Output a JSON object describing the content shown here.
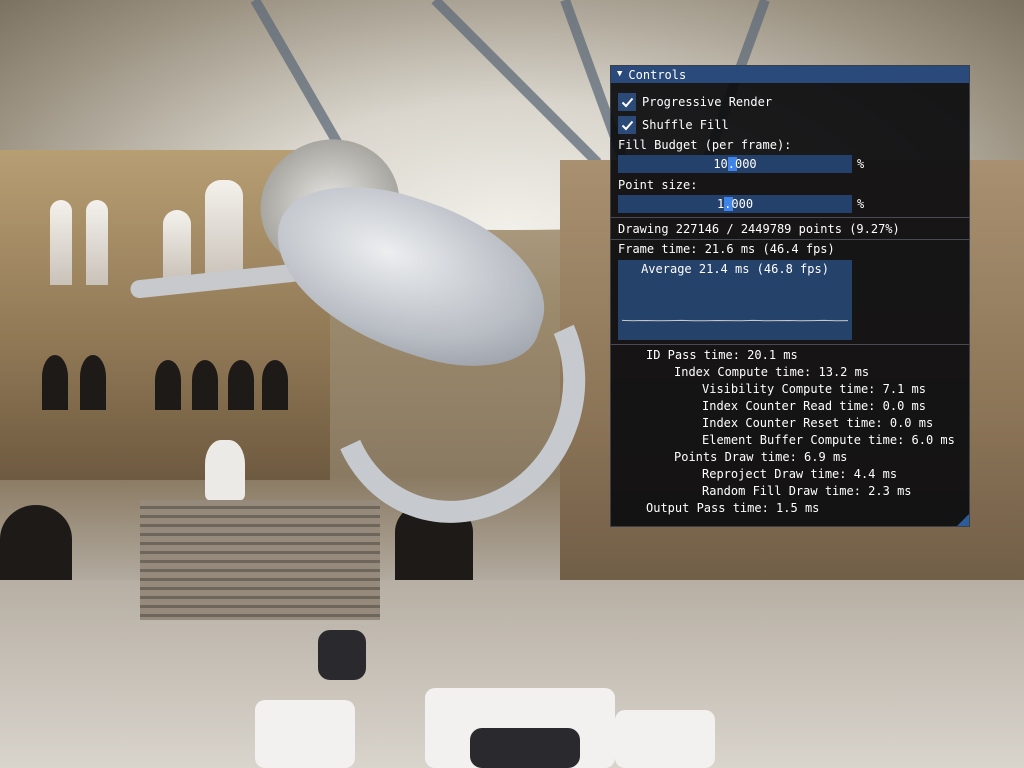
{
  "window": {
    "title": "Controls"
  },
  "controls": {
    "progressive_render": {
      "label": "Progressive Render",
      "checked": true
    },
    "shuffle_fill": {
      "label": "Shuffle Fill",
      "checked": true
    },
    "fill_budget": {
      "label": "Fill Budget (per frame):",
      "value": "10.000",
      "suffix": "%",
      "fraction": 0.49
    },
    "point_size": {
      "label": "Point size:",
      "value": "1.000",
      "suffix": "%",
      "fraction": 0.47
    },
    "drawing_stats": "Drawing 227146 / 2449789 points (9.27%)",
    "frame_time": "Frame time: 21.6 ms (46.4 fps)",
    "plot": {
      "overlay": "Average 21.4 ms (46.8 fps)",
      "samples": [
        21.6,
        21.3,
        21.5,
        21.2,
        21.4,
        21.7,
        21.3,
        21.1,
        21.5,
        21.4,
        21.2,
        21.6,
        21.3,
        21.4,
        21.5,
        21.2,
        21.4,
        21.6,
        21.3,
        21.4
      ],
      "scale_max": 100
    },
    "timings": [
      {
        "level": 0,
        "text": "ID Pass time: 20.1 ms"
      },
      {
        "level": 1,
        "text": "Index Compute time: 13.2 ms"
      },
      {
        "level": 2,
        "text": "Visibility Compute time: 7.1 ms"
      },
      {
        "level": 2,
        "text": "Index Counter Read time: 0.0 ms"
      },
      {
        "level": 2,
        "text": "Index Counter Reset time: 0.0 ms"
      },
      {
        "level": 2,
        "text": "Element Buffer Compute time: 6.0 ms"
      },
      {
        "level": 1,
        "text": "Points Draw time: 6.9 ms"
      },
      {
        "level": 2,
        "text": "Reproject Draw time: 4.4 ms"
      },
      {
        "level": 2,
        "text": "Random Fill Draw time: 2.3 ms"
      },
      {
        "level": 0,
        "text": "Output Pass time: 1.5 ms"
      }
    ]
  },
  "colors": {
    "title_bg": "#294a7a",
    "frame_bg": "#24416b",
    "slider_grab": "#3f84e6",
    "window_bg": "#0e0e10"
  },
  "icons": {
    "collapse": "triangle-down",
    "checkmark": "check"
  }
}
